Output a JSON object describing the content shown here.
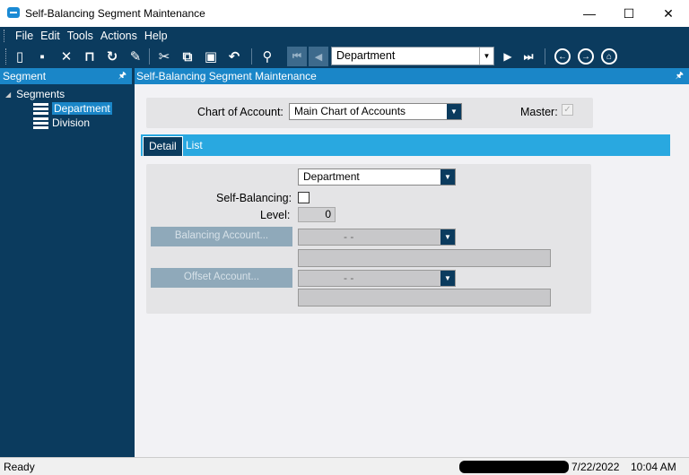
{
  "window": {
    "title": "Self-Balancing Segment Maintenance",
    "min_glyph": "—",
    "max_glyph": "☐",
    "close_glyph": "✕"
  },
  "menu": [
    "File",
    "Edit",
    "Tools",
    "Actions",
    "Help"
  ],
  "toolbar": {
    "icons": [
      "new-icon",
      "save-icon",
      "delete-icon",
      "book-icon",
      "refresh-icon",
      "broom-icon",
      "cut-icon",
      "copy-icon",
      "paste-icon",
      "undo-icon",
      "binoculars-icon",
      "first-record-icon",
      "previous-record-icon",
      "next-record-icon",
      "last-record-icon",
      "back-icon",
      "forward-icon",
      "home-icon"
    ],
    "glyphs": {
      "new": "▯",
      "save": "▪",
      "delete": "✕",
      "book": "⊓",
      "refresh": "↻",
      "broom": "✎",
      "cut": "✂",
      "copy": "⧉",
      "paste": "▣",
      "undo": "↶",
      "binoculars": "⚲",
      "first": "⏮",
      "previous": "◀",
      "next": "▶",
      "last": "⏭",
      "back": "←",
      "forward": "→",
      "home": "⌂"
    },
    "segment_selector": "Department"
  },
  "left_panel": {
    "title": "Segment",
    "pin_glyph": "🖈",
    "tree_root": "Segments",
    "tree_items": [
      "Department",
      "Division"
    ],
    "selected_item": "Department"
  },
  "main": {
    "title": "Self-Balancing Segment Maintenance",
    "chart_of_account_label": "Chart of Account:",
    "chart_of_account_value": "Main Chart of Accounts",
    "master_label": "Master:",
    "master_checked": true,
    "tabs": [
      "Detail",
      "List"
    ],
    "active_tab": "Detail",
    "segment_value": "Department",
    "self_balancing_label": "Self-Balancing:",
    "self_balancing_checked": false,
    "level_label": "Level:",
    "level_value": "0",
    "balancing_account_button": "Balancing Account...",
    "balancing_account_value": "-    -",
    "offset_account_button": "Offset Account...",
    "offset_account_value": "-    -"
  },
  "status": {
    "text": "Ready",
    "date": "7/22/2022",
    "time": "10:04 AM"
  },
  "colors": {
    "dark_navy": "#0b3b5e",
    "accent_blue": "#1a86c8",
    "tab_blue": "#29a8e0"
  }
}
